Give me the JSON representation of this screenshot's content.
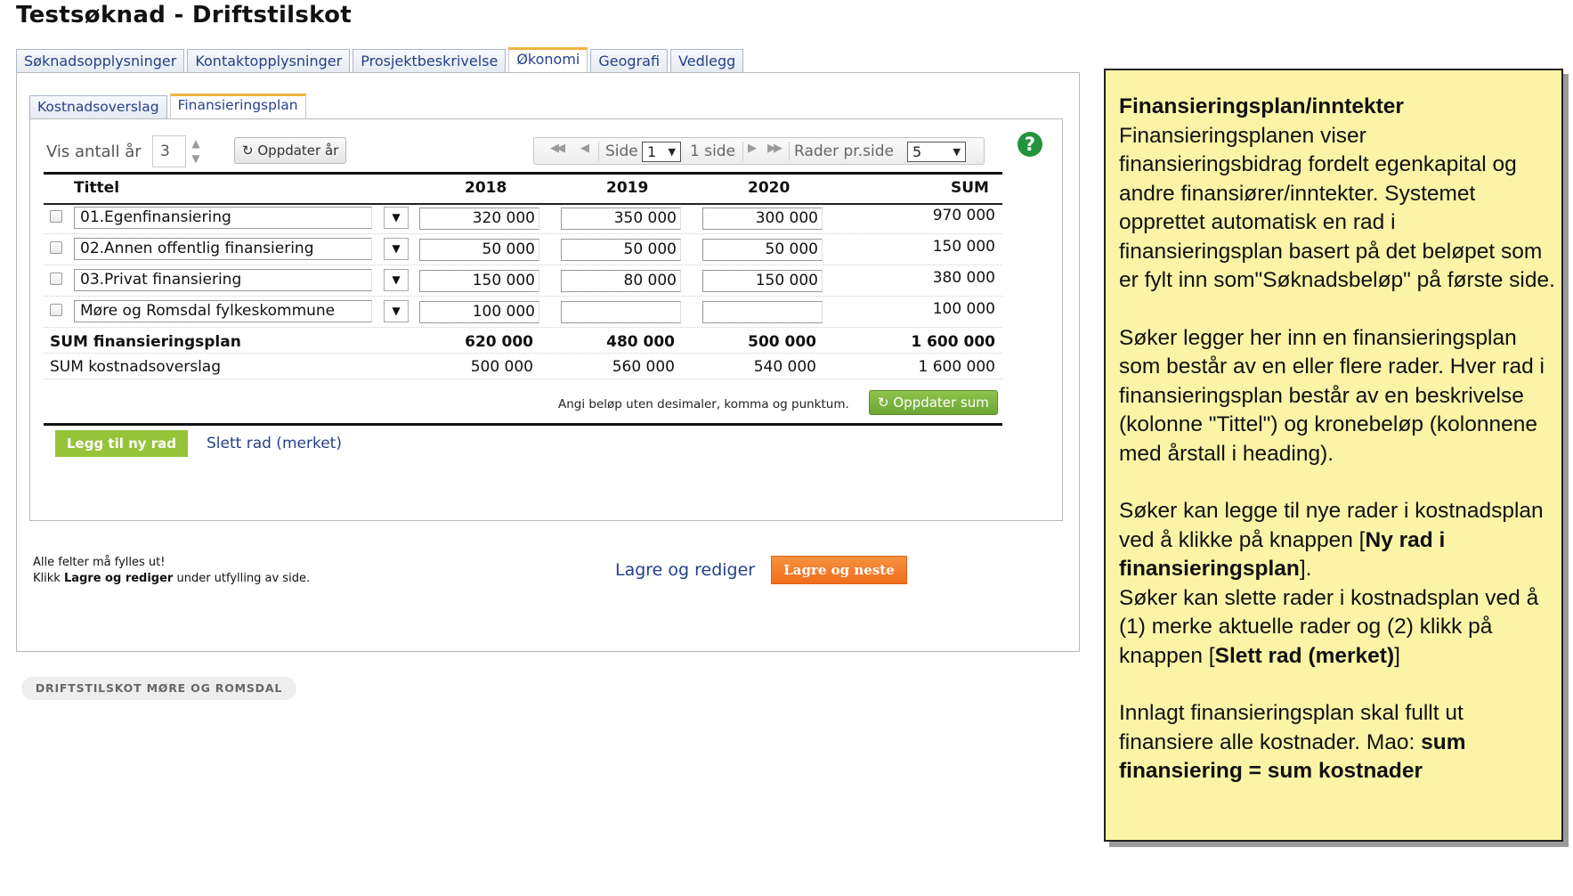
{
  "page": {
    "title": "Testsøknad - Driftstilskot"
  },
  "tabs_outer": [
    "Søknadsopplysninger",
    "Kontaktopplysninger",
    "Prosjektbeskrivelse",
    "Økonomi",
    "Geografi",
    "Vedlegg"
  ],
  "tabs_inner": [
    "Kostnadsoverslag",
    "Finansieringsplan"
  ],
  "toolbar": {
    "vis_label": "Vis antall år",
    "years_value": "3",
    "update_years_label": "Oppdater år",
    "side_label": "Side",
    "page_value": "1",
    "page_count_label": "1 side",
    "rows_label": "Rader pr.side",
    "rows_value": "5"
  },
  "table": {
    "headers": {
      "title": "Tittel",
      "y1": "2018",
      "y2": "2019",
      "y3": "2020",
      "sum": "SUM"
    },
    "rows": [
      {
        "title": "01.Egenfinansiering",
        "y1": "320 000",
        "y2": "350 000",
        "y3": "300 000",
        "sum": "970 000"
      },
      {
        "title": "02.Annen offentlig finansiering",
        "y1": "50 000",
        "y2": "50 000",
        "y3": "50 000",
        "sum": "150 000"
      },
      {
        "title": "03.Privat finansiering",
        "y1": "150 000",
        "y2": "80 000",
        "y3": "150 000",
        "sum": "380 000"
      },
      {
        "title": "Møre og Romsdal fylkeskommune",
        "y1": "100 000",
        "y2": "",
        "y3": "",
        "sum": "100 000"
      }
    ],
    "sum_plan": {
      "label": "SUM finansieringsplan",
      "y1": "620 000",
      "y2": "480 000",
      "y3": "500 000",
      "sum": "1 600 000"
    },
    "sum_cost": {
      "label": "SUM kostnadsoverslag",
      "y1": "500 000",
      "y2": "560 000",
      "y3": "540 000",
      "sum": "1 600 000"
    },
    "hint": "Angi beløp uten desimaler, komma og punktum.",
    "update_sum_label": "Oppdater sum"
  },
  "actions": {
    "add_row": "Legg til ny rad",
    "delete_row": "Slett rad (merket)",
    "save_edit": "Lagre og rediger",
    "save_next": "Lagre og neste"
  },
  "notes": {
    "line1": "Alle felter må fylles ut!",
    "line2_prefix": "Klikk ",
    "line2_bold": "Lagre og rediger",
    "line2_suffix": " under utfylling av side."
  },
  "footer": {
    "badge": "DRIFTSTILSKOT MØRE OG ROMSDAL"
  },
  "callout": {
    "heading": "Finansieringsplan/inntekter",
    "p1": "Finansieringsplanen viser finansieringsbidrag fordelt egenkapital og andre finansiører/inntekter. Systemet opprettet automatisk en rad i finansieringsplan basert på det beløpet som er fylt inn som\"Søknadsbeløp\" på første side.",
    "p2": "Søker legger her inn en finansieringsplan som består av en eller flere rader. Hver rad i finansieringsplan består av en beskrivelse (kolonne \"Tittel\") og kronebeløp (kolonnene med årstall i heading).",
    "p3a": "Søker kan legge til nye rader i kostnadsplan ved å klikke på knappen [",
    "p3b": "Ny rad i finansieringsplan",
    "p3c": "].",
    "p3d": "Søker kan slette rader i kostnadsplan ved å (1) merke aktuelle rader og (2) klikk på knappen [",
    "p3e": "Slett rad (merket)",
    "p3f": "]",
    "p4a": "Innlagt finansieringsplan skal fullt ut finansiere alle kostnader. Mao: ",
    "p4b": "sum finansiering = sum kostnader"
  },
  "colors": {
    "link": "#24418a",
    "active_tab_accent": "#f0b240",
    "add_button": "#95c43a",
    "next_button": "#f06d1c",
    "help_icon": "#23943c",
    "callout_bg": "#fbf3a6"
  }
}
